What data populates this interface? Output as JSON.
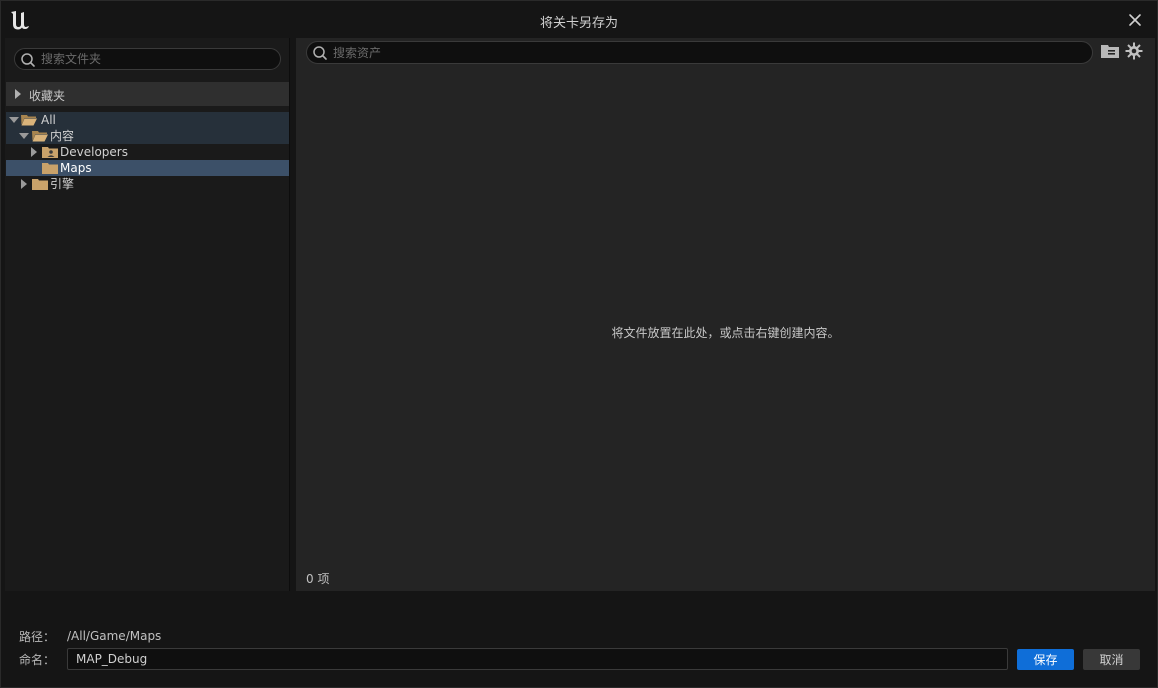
{
  "window": {
    "title": "将关卡另存为"
  },
  "folder_panel": {
    "search_placeholder": "搜索文件夹",
    "favorites_label": "收藏夹",
    "tree": [
      {
        "label": "All",
        "expanded": true
      },
      {
        "label": "内容",
        "expanded": true
      },
      {
        "label": "Developers",
        "expanded": false
      },
      {
        "label": "Maps",
        "selected": true
      },
      {
        "label": "引擎",
        "expanded": false
      }
    ]
  },
  "asset_panel": {
    "search_placeholder": "搜索资产",
    "empty_message": "将文件放置在此处，或点击右键创建内容。",
    "item_count": "0 项"
  },
  "footer": {
    "path_label": "路径：",
    "path_value": "/All/Game/Maps",
    "name_label": "命名：",
    "name_value": "MAP_Debug",
    "save_label": "保存",
    "cancel_label": "取消"
  },
  "colors": {
    "accent": "#0f6ed8",
    "folder": "#c9a26a",
    "selected_row": "#3c5068"
  }
}
